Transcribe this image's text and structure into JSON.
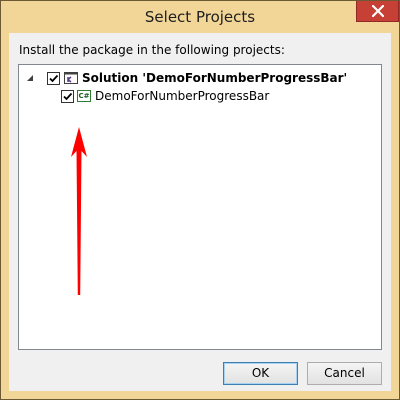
{
  "window": {
    "title": "Select Projects"
  },
  "instruction": "Install the package in the following projects:",
  "tree": {
    "solution": {
      "label": "Solution 'DemoForNumberProgressBar'",
      "checked": true,
      "expanded": true,
      "icon": "solution-icon"
    },
    "project": {
      "label": "DemoForNumberProgressBar",
      "checked": true,
      "icon_text": "C#",
      "icon": "csharp-project-icon"
    }
  },
  "buttons": {
    "ok_label": "OK",
    "cancel_label": "Cancel"
  },
  "colors": {
    "titlebar": "#f2d698",
    "close_button": "#c74035",
    "annotation_arrow": "#ff0000"
  }
}
